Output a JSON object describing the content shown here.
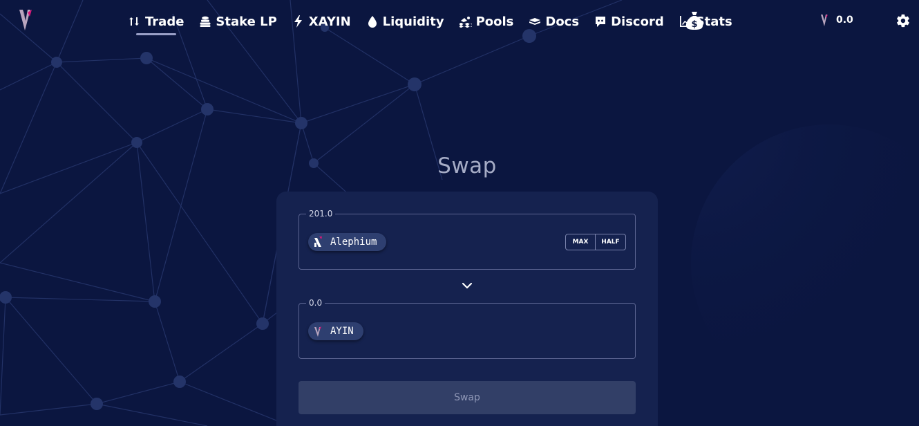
{
  "nav": {
    "items": [
      {
        "label": "Trade",
        "icon": "swap-vertical-icon",
        "active": true
      },
      {
        "label": "Stake LP",
        "icon": "coins-stack-icon",
        "active": false
      },
      {
        "label": "XAYIN",
        "icon": "bolt-icon",
        "active": false
      },
      {
        "label": "Liquidity",
        "icon": "droplet-icon",
        "active": false
      },
      {
        "label": "Pools",
        "icon": "swimming-icon",
        "active": false
      },
      {
        "label": "Docs",
        "icon": "book-icon",
        "active": false
      },
      {
        "label": "Discord",
        "icon": "discord-icon",
        "active": false
      },
      {
        "label": "Stats",
        "icon": "chart-line-icon",
        "active": false
      }
    ],
    "rewards_icon": "money-bag-icon",
    "balance": "0.0",
    "settings_icon": "gear-icon"
  },
  "swap": {
    "title": "Swap",
    "from": {
      "legend": "201.0",
      "token": "Alephium",
      "max_label": "MAX",
      "half_label": "HALF"
    },
    "switch_icon": "chevron-down-icon",
    "to": {
      "legend": "0.0",
      "token": "AYIN"
    },
    "button_label": "Swap"
  },
  "colors": {
    "background": "#0b1640",
    "card": "#15224f",
    "accent_pink": "#e0167a",
    "muted_text": "#a6acc6"
  }
}
